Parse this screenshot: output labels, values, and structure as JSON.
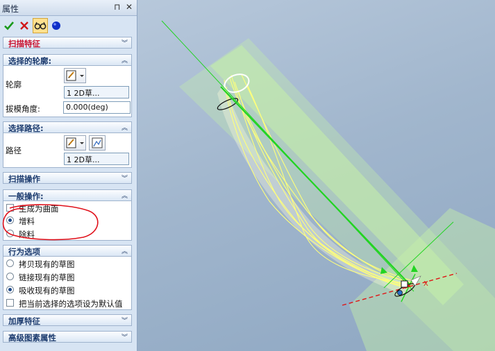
{
  "panel": {
    "title": "属性",
    "pin_glyph": "⊓",
    "close_glyph": "✕",
    "toolbar": {
      "ok_icon": "check-icon",
      "cancel_icon": "x-icon",
      "preview_icon": "glasses-icon",
      "dot_icon": "blue-dot-icon",
      "ok_color": "#1b9a1b",
      "cancel_color": "#d01818"
    },
    "sweep_feature": {
      "label": "扫描特征",
      "color": "#c8102e"
    },
    "profile_section": {
      "label": "选择的轮廓:",
      "profile_label": "轮廓",
      "profile_item": "1   2D草...",
      "draft_label": "拔模角度:",
      "draft_value": "0.000(deg)"
    },
    "path_section": {
      "label": "选择路径:",
      "path_label": "路径",
      "path_item": "1   2D草..."
    },
    "sweep_ops": {
      "label": "扫描操作"
    },
    "general_ops": {
      "label": "一般操作:",
      "options": [
        {
          "label": "生成为曲面",
          "type": "checkbox",
          "checked": false
        },
        {
          "label": "增料",
          "type": "radio",
          "checked": true
        },
        {
          "label": "除料",
          "type": "radio",
          "checked": false
        }
      ]
    },
    "behavior": {
      "label": "行为选项",
      "options": [
        {
          "label": "拷贝现有的草图",
          "type": "radio",
          "checked": false
        },
        {
          "label": "链接现有的草图",
          "type": "radio",
          "checked": false
        },
        {
          "label": "吸收现有的草图",
          "type": "radio",
          "checked": true
        },
        {
          "label": "把当前选择的选项设为默认值",
          "type": "checkbox",
          "checked": false
        }
      ]
    },
    "thicken": {
      "label": "加厚特征"
    },
    "advanced": {
      "label": "高级图素属性"
    },
    "chevron_up": "︽",
    "chevron_down": "︾"
  },
  "viewport": {
    "axis_label": "X",
    "colors": {
      "plane": "#c6f0a8",
      "sweep": "#ffff7a",
      "axis_green": "#22d422",
      "axis_red": "#e01515",
      "annotation": "#e0101a"
    }
  }
}
